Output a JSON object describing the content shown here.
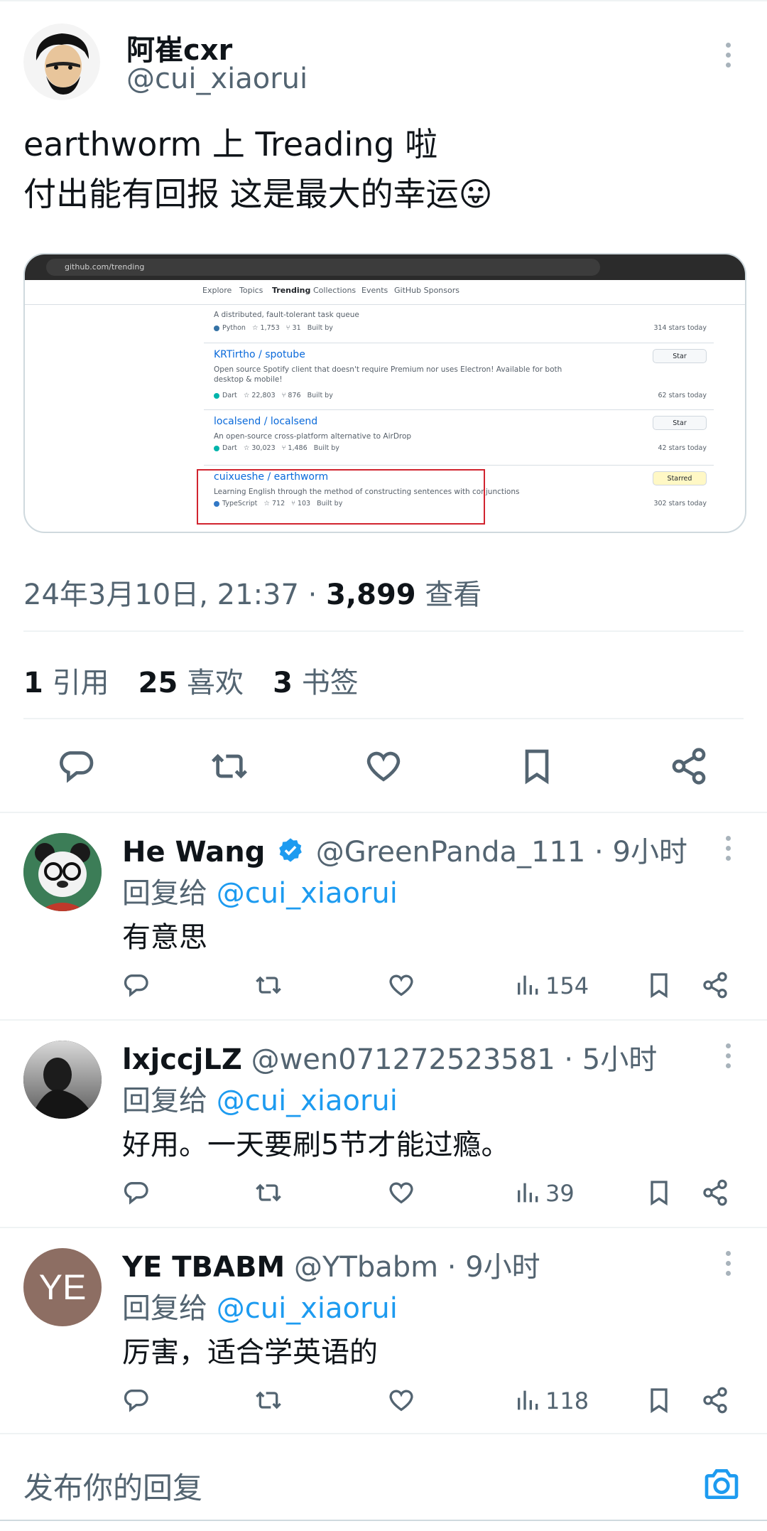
{
  "main_tweet": {
    "author_name": "阿崔cxr",
    "author_handle": "@cui_xiaorui",
    "text_line1": "earthworm 上 Treading 啦",
    "text_line2": "付出能有回报 这是最大的幸运😛",
    "timestamp": "24年3月10日, 21:37 · ",
    "views_count": "3,899",
    "views_label": " 查看",
    "stats": {
      "quotes_count": "1",
      "quotes_label": "引用",
      "likes_count": "25",
      "likes_label": "喜欢",
      "bookmarks_count": "3",
      "bookmarks_label": "书签"
    }
  },
  "embedded_screenshot": {
    "url": "github.com/trending",
    "nav": [
      "Explore",
      "Topics",
      "Trending",
      "Collections",
      "Events",
      "GitHub Sponsors"
    ],
    "active_nav": "Trending",
    "repos": [
      {
        "title": "",
        "desc": "A distributed, fault-tolerant task queue",
        "lang": "Python",
        "stars": "1,753",
        "forks": "31",
        "built_by": "Built by",
        "today": "314 stars today",
        "lang_color": "#3572A5"
      },
      {
        "title": "KRTirtho / spotube",
        "desc": "Open source Spotify client that doesn't require Premium nor uses Electron! Available for both desktop & mobile!",
        "lang": "Dart",
        "stars": "22,803",
        "forks": "876",
        "built_by": "Built by",
        "today": "62 stars today",
        "star_btn": "Star",
        "lang_color": "#00B4AB"
      },
      {
        "title": "localsend / localsend",
        "desc": "An open-source cross-platform alternative to AirDrop",
        "lang": "Dart",
        "stars": "30,023",
        "forks": "1,486",
        "built_by": "Built by",
        "today": "42 stars today",
        "star_btn": "Star",
        "lang_color": "#00B4AB"
      },
      {
        "title": "cuixueshe / earthworm",
        "desc": "Learning English through the method of constructing sentences with conjunctions",
        "lang": "TypeScript",
        "stars": "712",
        "forks": "103",
        "built_by": "Built by",
        "today": "302 stars today",
        "star_btn": "Starred",
        "lang_color": "#3178C6"
      }
    ]
  },
  "replies": [
    {
      "name": "He Wang",
      "verified": true,
      "handle": "@GreenPanda_111",
      "time": " · 9小时",
      "reply_prefix": "回复给 ",
      "reply_to": "@cui_xiaorui",
      "text": "有意思",
      "views": "154"
    },
    {
      "name": "lxjccjLZ",
      "verified": false,
      "handle": "@wen071272523581",
      "time": " · 5小时",
      "reply_prefix": "回复给 ",
      "reply_to": "@cui_xiaorui",
      "text": "好用。一天要刷5节才能过瘾。",
      "views": "39"
    },
    {
      "name": "YE TBABM",
      "verified": false,
      "handle": "@YTbabm",
      "time": " · 9小时",
      "reply_prefix": "回复给 ",
      "reply_to": "@cui_xiaorui",
      "text": "厉害，适合学英语的",
      "views": "118",
      "avatar_initials": "YE"
    }
  ],
  "compose": {
    "placeholder": "发布你的回复"
  },
  "colors": {
    "accent": "#1d9bf0",
    "text": "#0f1419",
    "secondary": "#536471",
    "border": "#eff3f4",
    "highlight_box": "#d1242f"
  }
}
